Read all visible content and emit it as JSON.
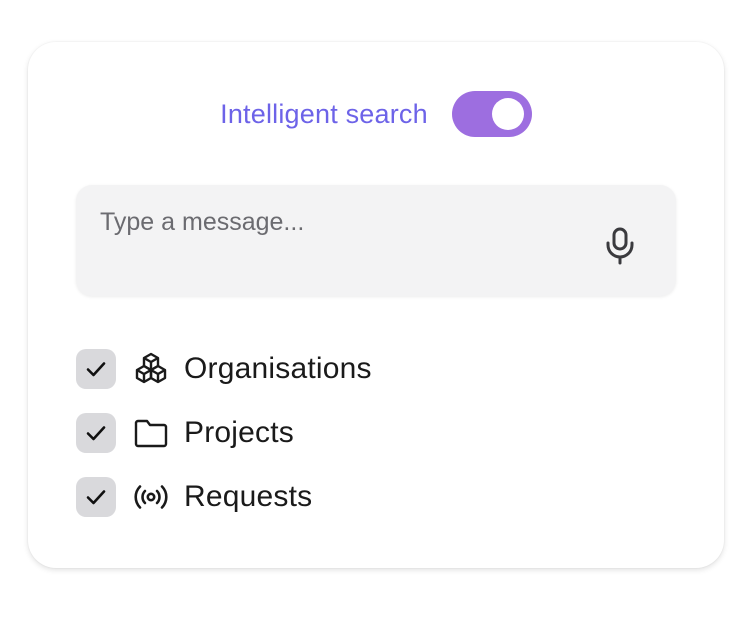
{
  "search": {
    "toggle_label": "Intelligent search",
    "toggle_on": true,
    "accent_color": "#6d63e8",
    "toggle_color": "#9d6ee0",
    "placeholder": "Type a message...",
    "value": "",
    "mic_icon": "microphone-icon"
  },
  "filters": [
    {
      "label": "Organisations",
      "checked": true,
      "icon": "cubes-icon"
    },
    {
      "label": "Projects",
      "checked": true,
      "icon": "folder-icon"
    },
    {
      "label": "Requests",
      "checked": true,
      "icon": "broadcast-icon"
    }
  ]
}
